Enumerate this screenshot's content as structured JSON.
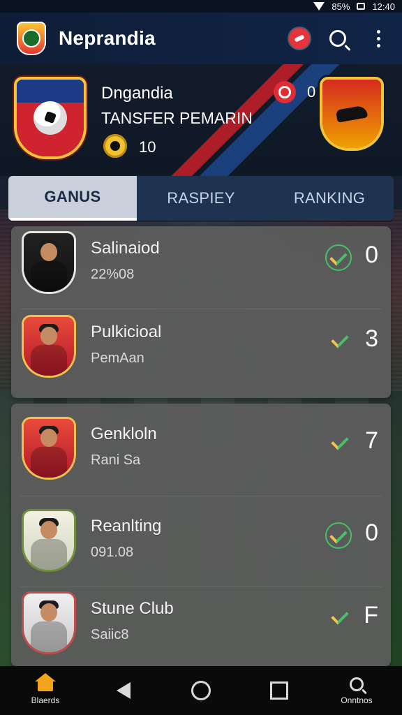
{
  "status_bar": {
    "battery_text": "85%",
    "time": "12:40"
  },
  "app_bar": {
    "title": "Neprandia"
  },
  "hero": {
    "club_name": "Dngandia",
    "subtitle": "TANSFER PEMARIN",
    "coins": "10",
    "alerts": "0"
  },
  "tabs": [
    {
      "label": "GANUS",
      "active": true
    },
    {
      "label": "RASPIEY",
      "active": false
    },
    {
      "label": "RANKING",
      "active": false
    }
  ],
  "players_group1": [
    {
      "name": "Salinaiod",
      "sub": "22%08",
      "stat_icon": "check-circle-icon",
      "value": "0",
      "avatar": "dark"
    },
    {
      "name": "Pulkicioal",
      "sub": "PemAan",
      "stat_icon": "check-icon",
      "value": "3",
      "avatar": "red"
    }
  ],
  "players_group2": [
    {
      "name": "Genkloln",
      "sub": "Rani Sa",
      "stat_icon": "check-icon",
      "value": "7",
      "avatar": "red"
    },
    {
      "name": "Reanlting",
      "sub": "091.08",
      "stat_icon": "check-circle-icon",
      "value": "0",
      "avatar": "olive"
    },
    {
      "name": "Stune Club",
      "sub": "Saiic8",
      "stat_icon": "check-icon",
      "value": "F",
      "avatar": "light"
    }
  ],
  "bottom_nav": [
    {
      "label": "Blaerds",
      "icon": "home-icon"
    },
    {
      "label": "",
      "icon": "back-icon"
    },
    {
      "label": "",
      "icon": "home-circle-icon"
    },
    {
      "label": "",
      "icon": "recent-apps-icon"
    },
    {
      "label": "Onntnos",
      "icon": "search-icon"
    }
  ]
}
